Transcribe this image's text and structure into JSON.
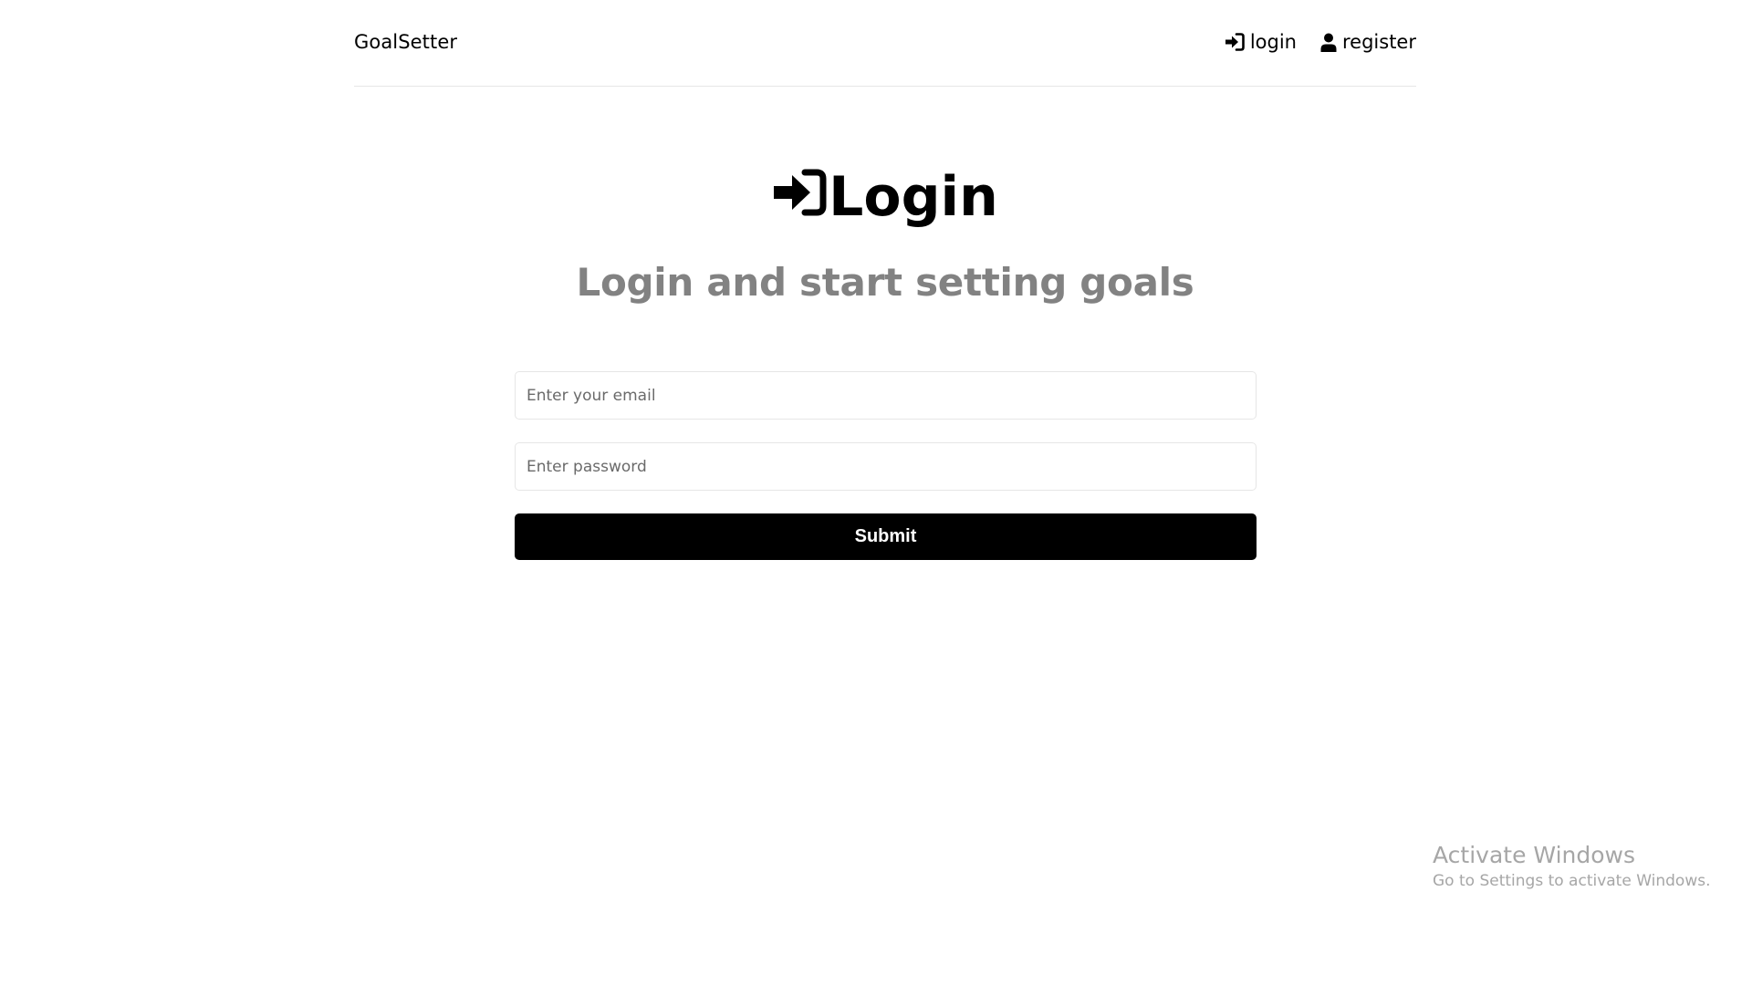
{
  "header": {
    "brand": "GoalSetter",
    "nav": {
      "login_label": "login",
      "register_label": "register"
    }
  },
  "main": {
    "title": "Login",
    "subtitle": "Login and start setting goals",
    "form": {
      "email_placeholder": "Enter your email",
      "email_value": "",
      "password_placeholder": "Enter password",
      "password_value": "",
      "submit_label": "Submit"
    }
  },
  "watermark": {
    "title": "Activate Windows",
    "subtitle": "Go to Settings to activate Windows."
  },
  "colors": {
    "subtitle": "#828282",
    "button_bg": "#000000",
    "button_text": "#ffffff",
    "border": "#e6e6e6"
  },
  "icons": {
    "login": "sign-in-icon",
    "register": "user-icon",
    "title": "sign-in-icon"
  }
}
